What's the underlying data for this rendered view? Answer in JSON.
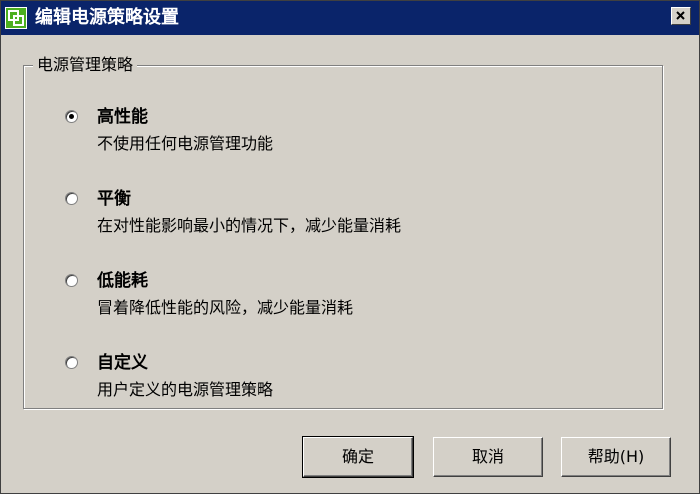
{
  "window": {
    "title": "编辑电源策略设置"
  },
  "group": {
    "label": "电源管理策略"
  },
  "options": [
    {
      "title": "高性能",
      "desc": "不使用任何电源管理功能",
      "selected": true
    },
    {
      "title": "平衡",
      "desc": "在对性能影响最小的情况下，减少能量消耗",
      "selected": false
    },
    {
      "title": "低能耗",
      "desc": "冒着降低性能的风险，减少能量消耗",
      "selected": false
    },
    {
      "title": "自定义",
      "desc": "用户定义的电源管理策略",
      "selected": false
    }
  ],
  "buttons": {
    "ok": "确定",
    "cancel": "取消",
    "help": "帮助(H)"
  },
  "colors": {
    "titlebar": "#0a246a",
    "face": "#d4d0c8",
    "icon_green": "#4caf1f"
  }
}
